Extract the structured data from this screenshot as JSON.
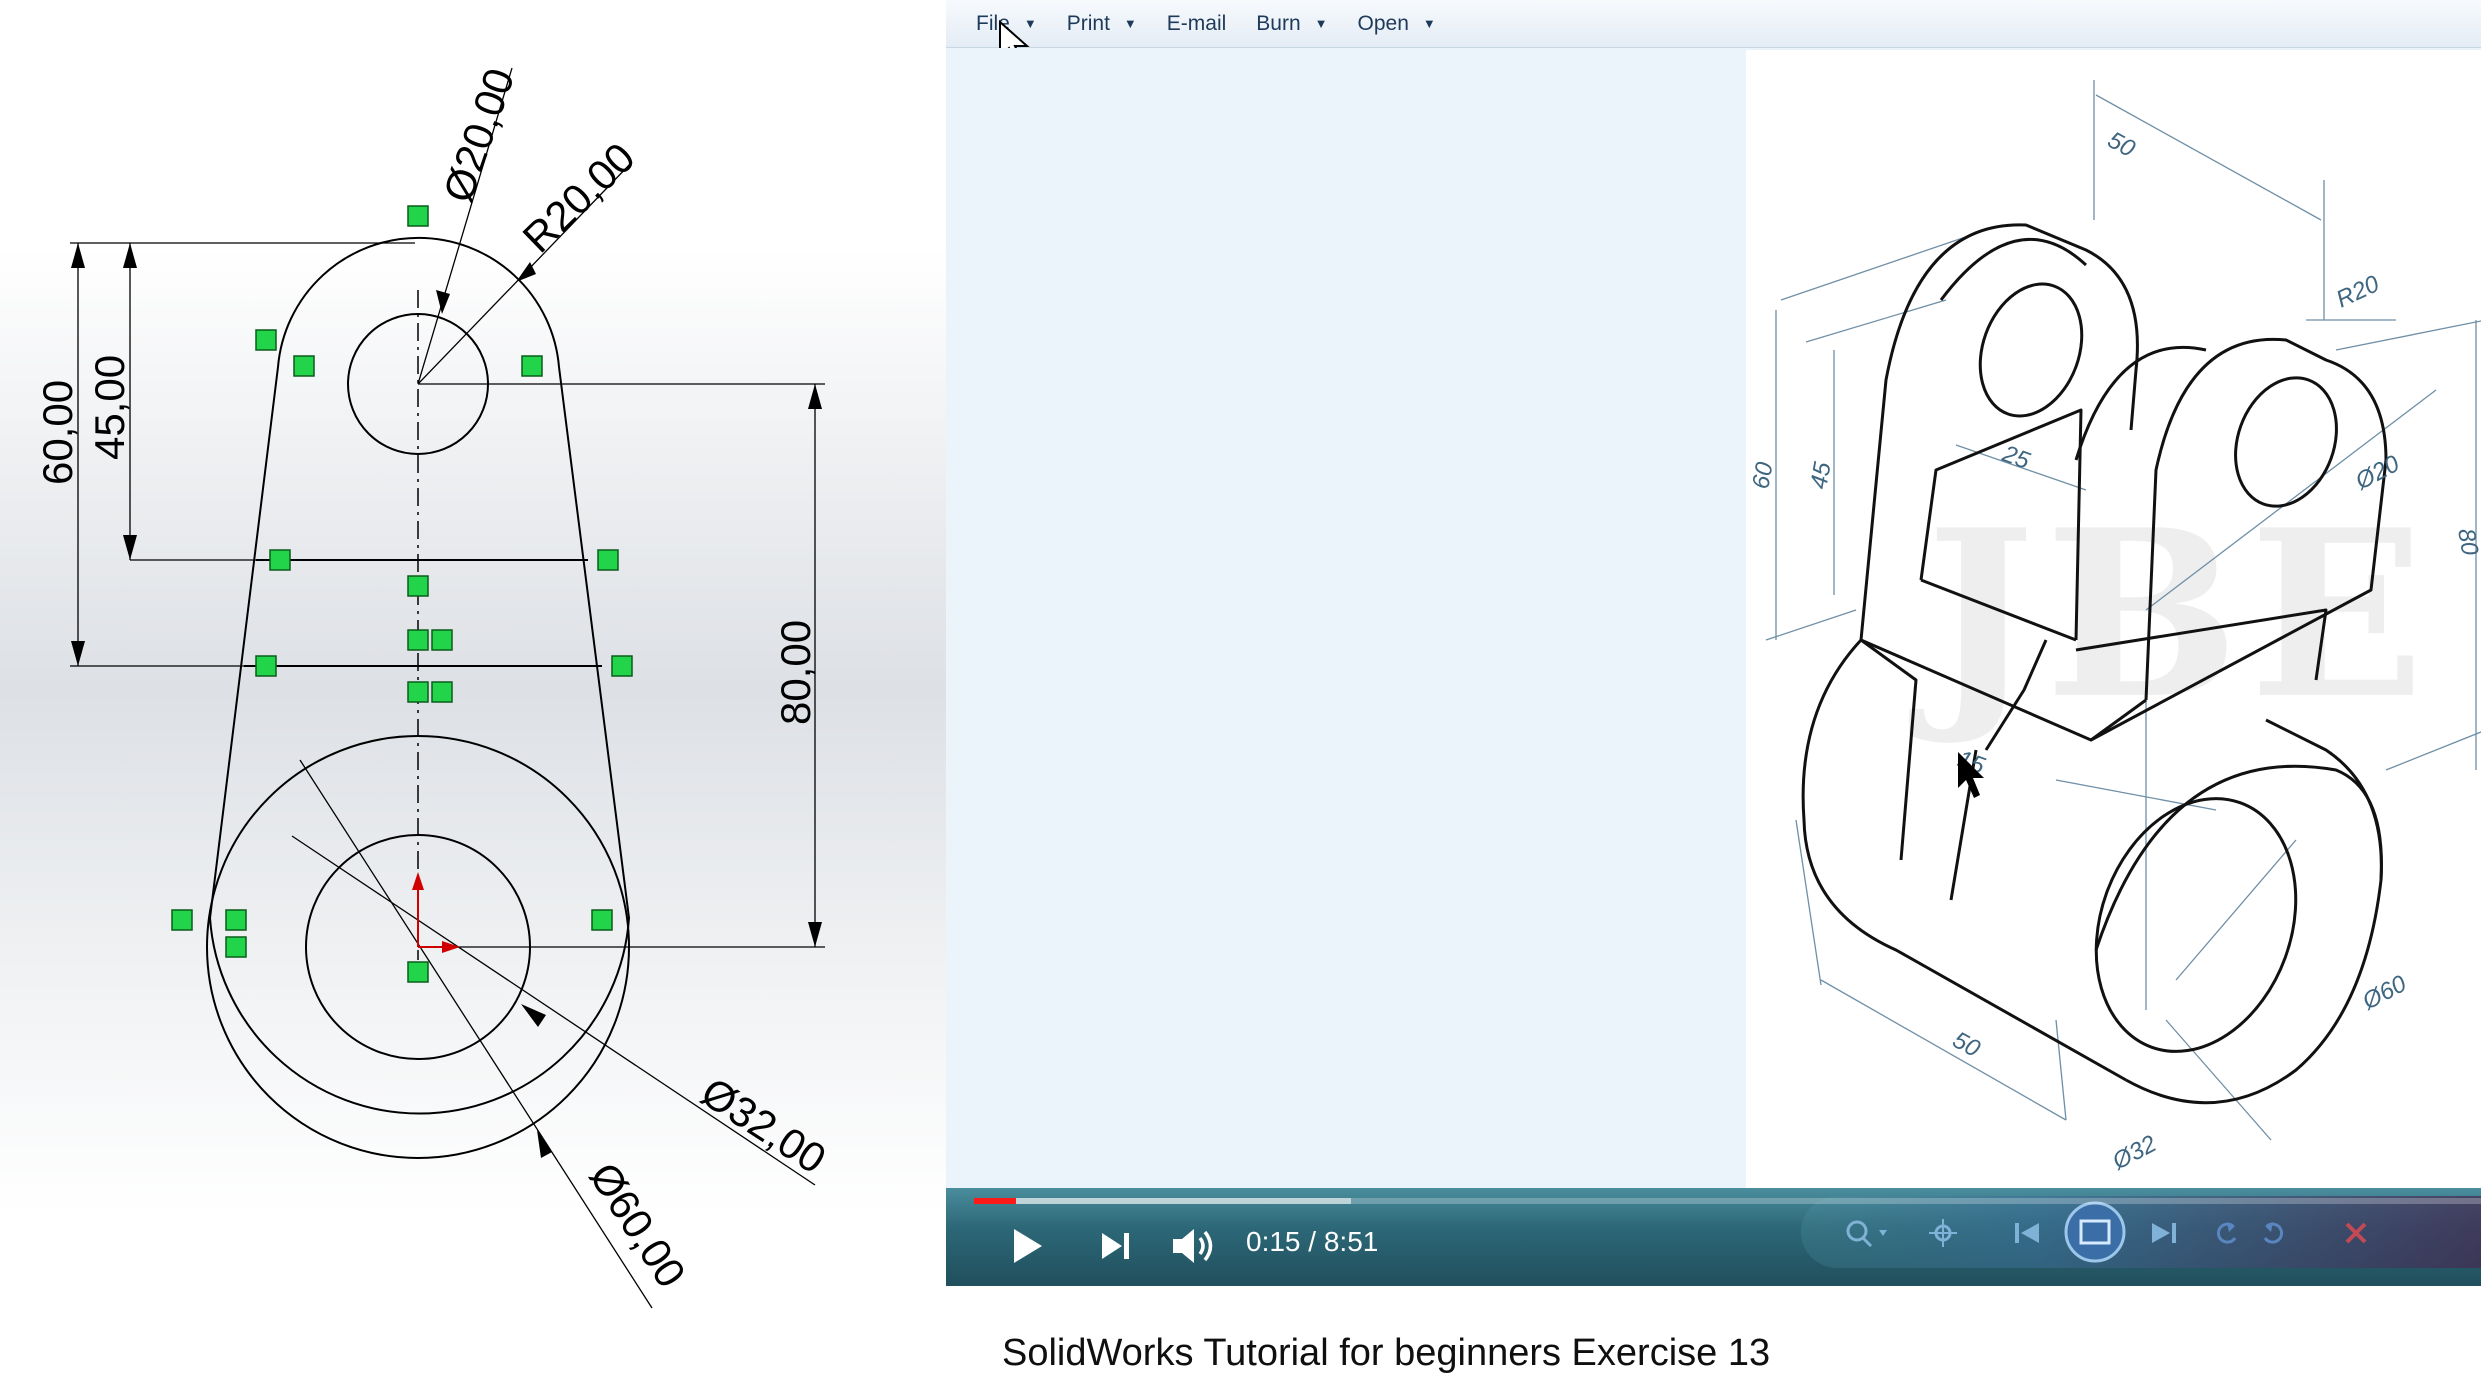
{
  "sketch": {
    "dimensions": {
      "dia_top": "Ø20,00",
      "radius_top": "R20,00",
      "height_total": "60,00",
      "height_inner": "45,00",
      "center_distance": "80,00",
      "dia_inner_bottom": "Ø32,00",
      "dia_outer_bottom": "Ø60,00"
    }
  },
  "menu": {
    "items": [
      {
        "label": "File",
        "has_dropdown": true
      },
      {
        "label": "Print",
        "has_dropdown": true
      },
      {
        "label": "E-mail",
        "has_dropdown": false
      },
      {
        "label": "Burn",
        "has_dropdown": true
      },
      {
        "label": "Open",
        "has_dropdown": true
      }
    ]
  },
  "drawing": {
    "labels": {
      "width_top": "50",
      "radius": "R20",
      "height_60": "60",
      "height_45": "45",
      "web_25": "25",
      "hole_20": "Ø20",
      "height_80": "80",
      "web_15": "15",
      "width_bottom": "50",
      "dia_60": "Ø60",
      "dia_32": "Ø32"
    },
    "watermark": "JBE"
  },
  "player": {
    "time_current": "0:15",
    "time_total": "8:51",
    "time_separator": "/",
    "progress_fraction": 0.028,
    "buffered_fraction": 0.25,
    "accent_color": "#ff1a1a"
  },
  "video": {
    "title": "SolidWorks Tutorial for beginners Exercise 13"
  }
}
